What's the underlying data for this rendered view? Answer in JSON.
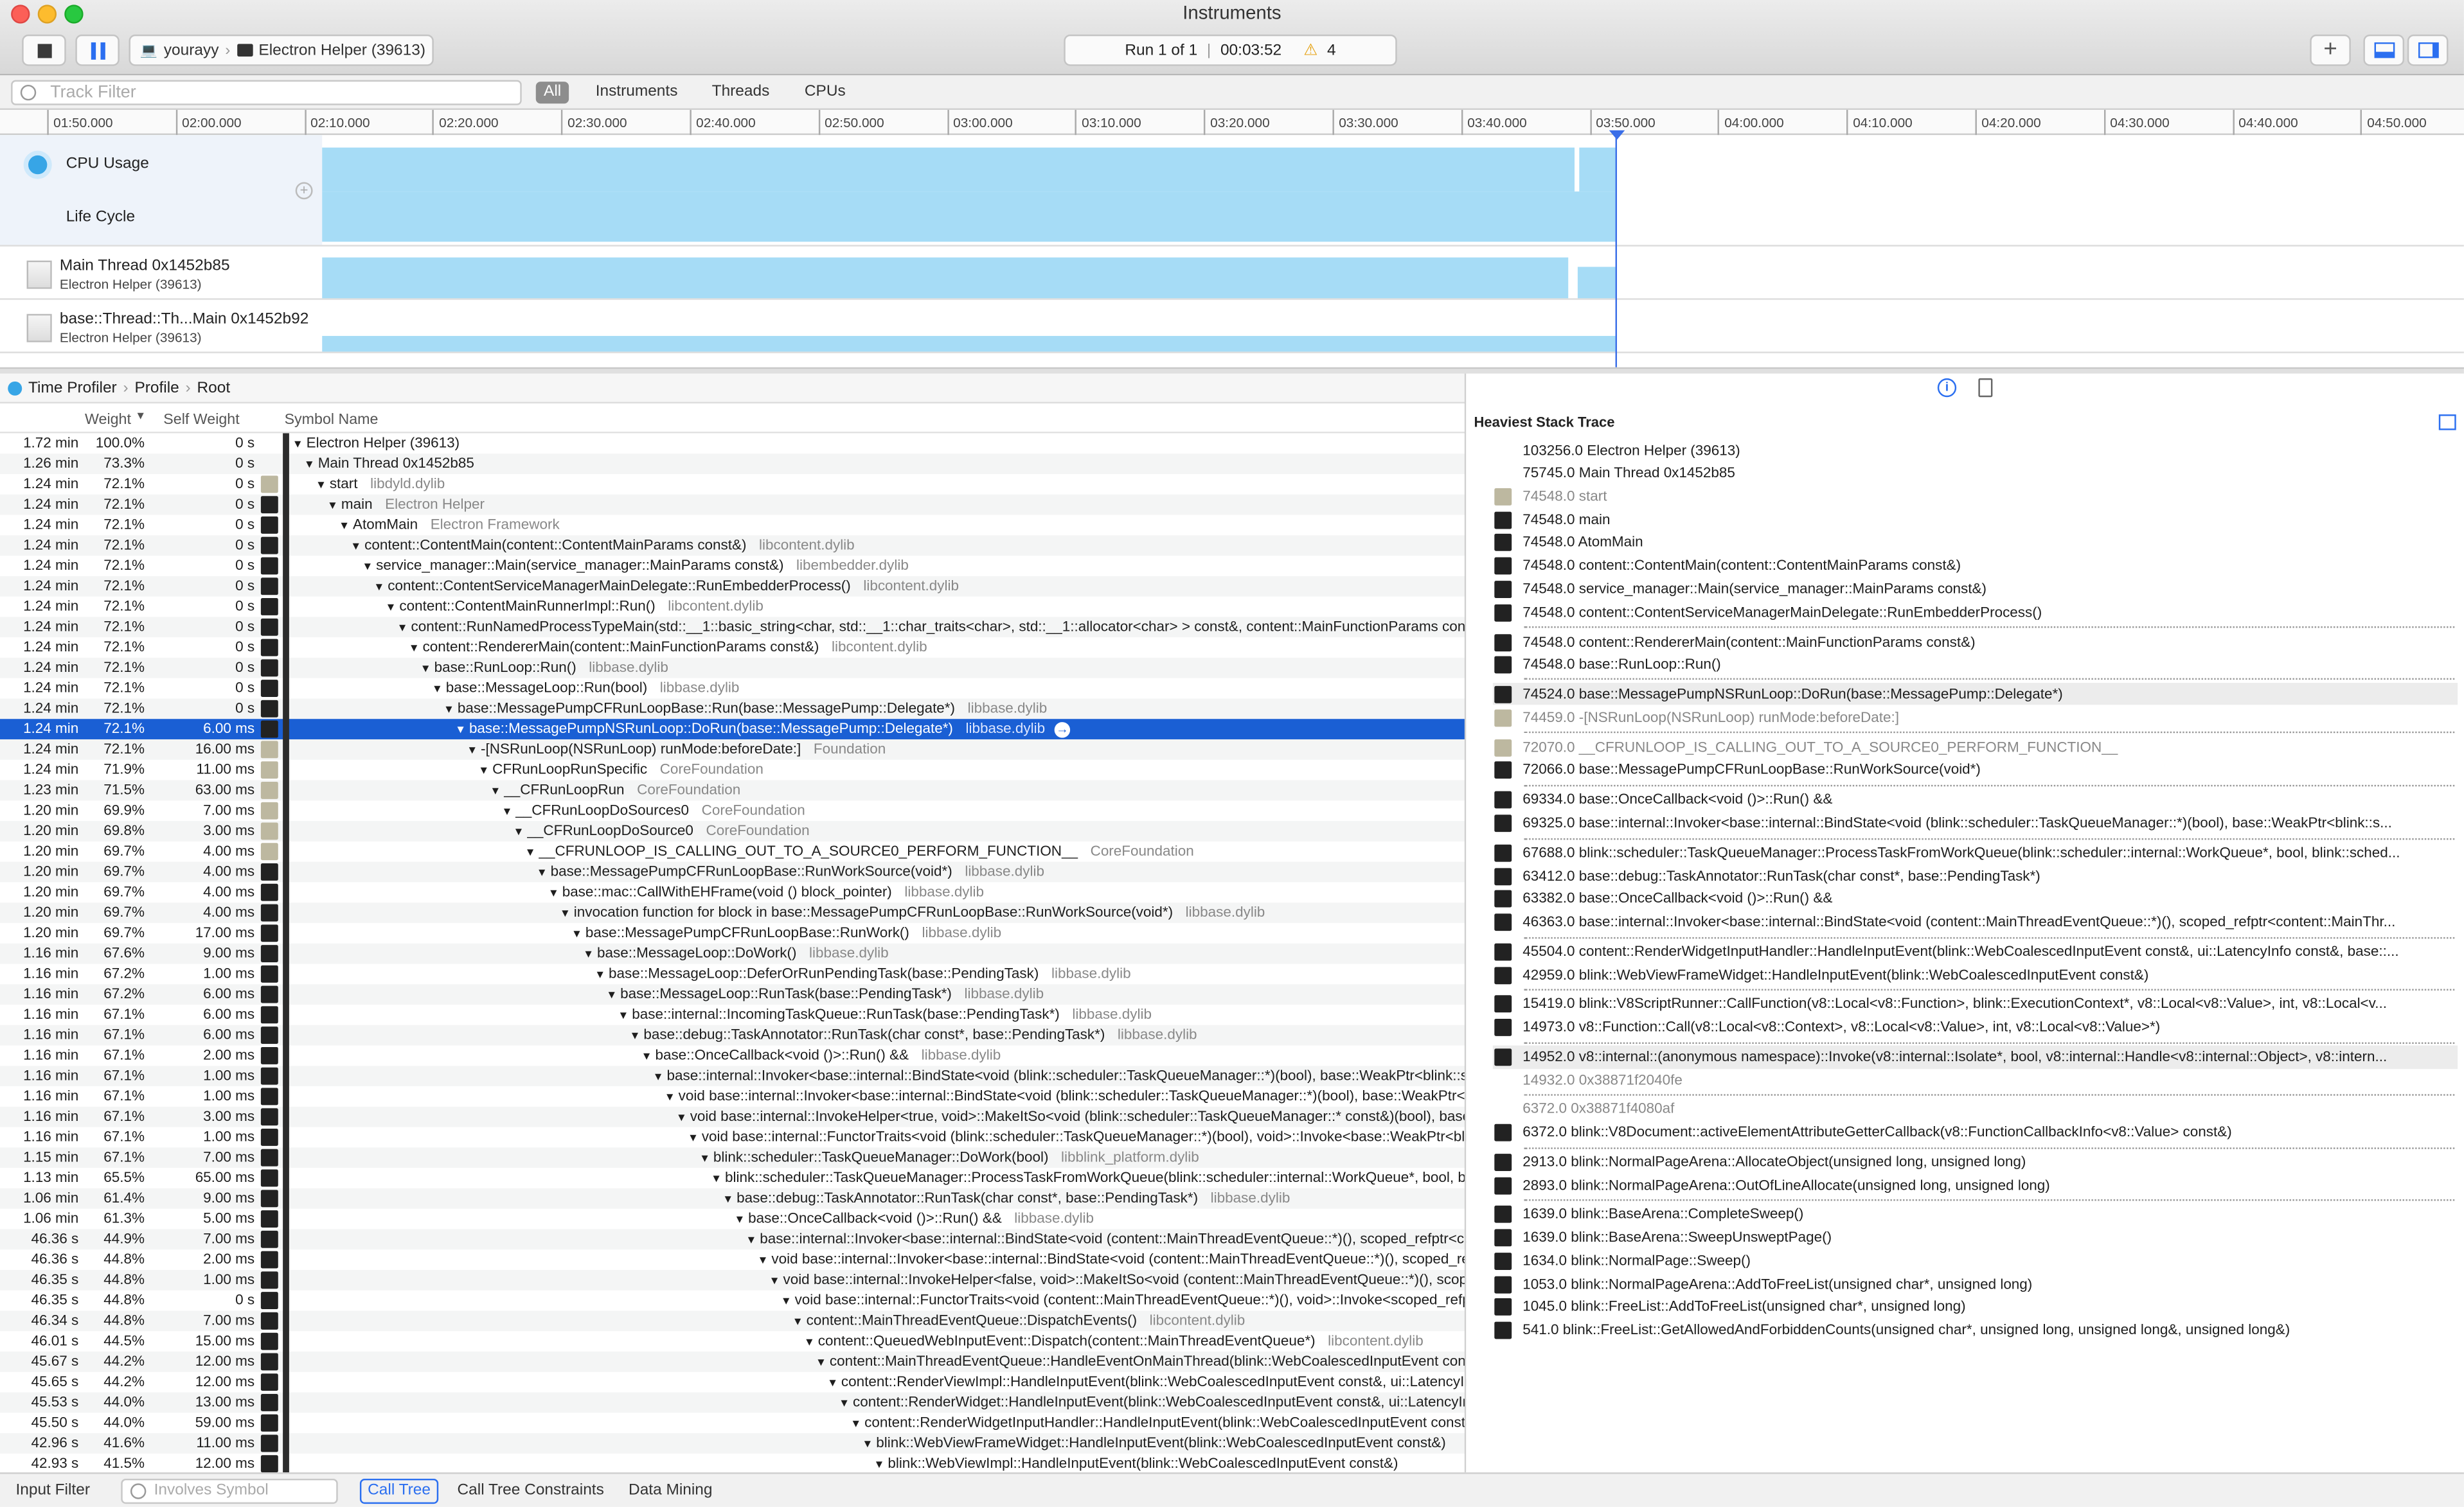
{
  "window": {
    "title": "Instruments"
  },
  "toolbar": {
    "target_device": "yourayy",
    "target_process": "Electron Helper (39613)",
    "run_label": "Run 1 of 1",
    "elapsed": "00:03:52",
    "warning_count": "4"
  },
  "filter": {
    "track_filter_placeholder": "Track Filter",
    "scopes": [
      "All",
      "Instruments",
      "Threads",
      "CPUs"
    ],
    "active_scope": "All"
  },
  "timeline": {
    "ticks": [
      "01:50.000",
      "02:00.000",
      "02:10.000",
      "02:20.000",
      "02:30.000",
      "02:40.000",
      "02:50.000",
      "03:00.000",
      "03:10.000",
      "03:20.000",
      "03:30.000",
      "03:40.000",
      "03:50.000",
      "04:00.000",
      "04:10.000",
      "04:20.000",
      "04:30.000",
      "04:40.000",
      "04:50.000"
    ]
  },
  "tracks": [
    {
      "label": "CPU Usage",
      "sub": ""
    },
    {
      "label": "Life Cycle",
      "sub": ""
    },
    {
      "label": "Main Thread  0x1452b85",
      "sub": "Electron Helper (39613)"
    },
    {
      "label": "base::Thread::Th...Main  0x1452b92",
      "sub": "Electron Helper (39613)"
    }
  ],
  "breadcrumb": {
    "items": [
      "Time Profiler",
      "Profile",
      "Root"
    ]
  },
  "call_tree": {
    "columns": {
      "weight": "Weight",
      "self_weight": "Self Weight",
      "symbol": "Symbol Name"
    },
    "rows": [
      {
        "w": "1.72 min",
        "p": "100.0%",
        "s": "0 s",
        "sym": "Electron Helper (39613)",
        "lib": "",
        "d": 0,
        "icon": "none"
      },
      {
        "w": "1.26 min",
        "p": "73.3%",
        "s": "0 s",
        "sym": "Main Thread  0x1452b85",
        "lib": "",
        "d": 1,
        "icon": "none"
      },
      {
        "w": "1.24 min",
        "p": "72.1%",
        "s": "0 s",
        "sym": "start",
        "lib": "libdyld.dylib",
        "d": 2,
        "icon": "sys"
      },
      {
        "w": "1.24 min",
        "p": "72.1%",
        "s": "0 s",
        "sym": "main",
        "lib": "Electron Helper",
        "d": 3,
        "icon": "user"
      },
      {
        "w": "1.24 min",
        "p": "72.1%",
        "s": "0 s",
        "sym": "AtomMain",
        "lib": "Electron Framework",
        "d": 4,
        "icon": "user"
      },
      {
        "w": "1.24 min",
        "p": "72.1%",
        "s": "0 s",
        "sym": "content::ContentMain(content::ContentMainParams const&)",
        "lib": "libcontent.dylib",
        "d": 5,
        "icon": "user"
      },
      {
        "w": "1.24 min",
        "p": "72.1%",
        "s": "0 s",
        "sym": "service_manager::Main(service_manager::MainParams const&)",
        "lib": "libembedder.dylib",
        "d": 6,
        "icon": "user"
      },
      {
        "w": "1.24 min",
        "p": "72.1%",
        "s": "0 s",
        "sym": "content::ContentServiceManagerMainDelegate::RunEmbedderProcess()",
        "lib": "libcontent.dylib",
        "d": 7,
        "icon": "user"
      },
      {
        "w": "1.24 min",
        "p": "72.1%",
        "s": "0 s",
        "sym": "content::ContentMainRunnerImpl::Run()",
        "lib": "libcontent.dylib",
        "d": 8,
        "icon": "user"
      },
      {
        "w": "1.24 min",
        "p": "72.1%",
        "s": "0 s",
        "sym": "content::RunNamedProcessTypeMain(std::__1::basic_string<char, std::__1::char_traits<char>, std::__1::allocator<char> > const&, content::MainFunctionParams const&, content::ContentMainDelegate*)",
        "lib": "",
        "d": 9,
        "icon": "user"
      },
      {
        "w": "1.24 min",
        "p": "72.1%",
        "s": "0 s",
        "sym": "content::RendererMain(content::MainFunctionParams const&)",
        "lib": "libcontent.dylib",
        "d": 10,
        "icon": "user"
      },
      {
        "w": "1.24 min",
        "p": "72.1%",
        "s": "0 s",
        "sym": "base::RunLoop::Run()",
        "lib": "libbase.dylib",
        "d": 11,
        "icon": "user"
      },
      {
        "w": "1.24 min",
        "p": "72.1%",
        "s": "0 s",
        "sym": "base::MessageLoop::Run(bool)",
        "lib": "libbase.dylib",
        "d": 12,
        "icon": "user"
      },
      {
        "w": "1.24 min",
        "p": "72.1%",
        "s": "0 s",
        "sym": "base::MessagePumpCFRunLoopBase::Run(base::MessagePump::Delegate*)",
        "lib": "libbase.dylib",
        "d": 13,
        "icon": "user"
      },
      {
        "w": "1.24 min",
        "p": "72.1%",
        "s": "6.00 ms",
        "sym": "base::MessagePumpNSRunLoop::DoRun(base::MessagePump::Delegate*)",
        "lib": "libbase.dylib",
        "d": 14,
        "icon": "user",
        "sel": true
      },
      {
        "w": "1.24 min",
        "p": "72.1%",
        "s": "16.00 ms",
        "sym": "-[NSRunLoop(NSRunLoop) runMode:beforeDate:]",
        "lib": "Foundation",
        "d": 15,
        "icon": "sys"
      },
      {
        "w": "1.24 min",
        "p": "71.9%",
        "s": "11.00 ms",
        "sym": "CFRunLoopRunSpecific",
        "lib": "CoreFoundation",
        "d": 16,
        "icon": "sys"
      },
      {
        "w": "1.23 min",
        "p": "71.5%",
        "s": "63.00 ms",
        "sym": "__CFRunLoopRun",
        "lib": "CoreFoundation",
        "d": 17,
        "icon": "sys"
      },
      {
        "w": "1.20 min",
        "p": "69.9%",
        "s": "7.00 ms",
        "sym": "__CFRunLoopDoSources0",
        "lib": "CoreFoundation",
        "d": 18,
        "icon": "sys"
      },
      {
        "w": "1.20 min",
        "p": "69.8%",
        "s": "3.00 ms",
        "sym": "__CFRunLoopDoSource0",
        "lib": "CoreFoundation",
        "d": 19,
        "icon": "sys"
      },
      {
        "w": "1.20 min",
        "p": "69.7%",
        "s": "4.00 ms",
        "sym": "__CFRUNLOOP_IS_CALLING_OUT_TO_A_SOURCE0_PERFORM_FUNCTION__",
        "lib": "CoreFoundation",
        "d": 20,
        "icon": "sys"
      },
      {
        "w": "1.20 min",
        "p": "69.7%",
        "s": "4.00 ms",
        "sym": "base::MessagePumpCFRunLoopBase::RunWorkSource(void*)",
        "lib": "libbase.dylib",
        "d": 21,
        "icon": "user"
      },
      {
        "w": "1.20 min",
        "p": "69.7%",
        "s": "4.00 ms",
        "sym": "base::mac::CallWithEHFrame(void () block_pointer)",
        "lib": "libbase.dylib",
        "d": 22,
        "icon": "user"
      },
      {
        "w": "1.20 min",
        "p": "69.7%",
        "s": "4.00 ms",
        "sym": "invocation function for block in base::MessagePumpCFRunLoopBase::RunWorkSource(void*)",
        "lib": "libbase.dylib",
        "d": 23,
        "icon": "user"
      },
      {
        "w": "1.20 min",
        "p": "69.7%",
        "s": "17.00 ms",
        "sym": "base::MessagePumpCFRunLoopBase::RunWork()",
        "lib": "libbase.dylib",
        "d": 24,
        "icon": "user"
      },
      {
        "w": "1.16 min",
        "p": "67.6%",
        "s": "9.00 ms",
        "sym": "base::MessageLoop::DoWork()",
        "lib": "libbase.dylib",
        "d": 25,
        "icon": "user"
      },
      {
        "w": "1.16 min",
        "p": "67.2%",
        "s": "1.00 ms",
        "sym": "base::MessageLoop::DeferOrRunPendingTask(base::PendingTask)",
        "lib": "libbase.dylib",
        "d": 26,
        "icon": "user"
      },
      {
        "w": "1.16 min",
        "p": "67.2%",
        "s": "6.00 ms",
        "sym": "base::MessageLoop::RunTask(base::PendingTask*)",
        "lib": "libbase.dylib",
        "d": 27,
        "icon": "user"
      },
      {
        "w": "1.16 min",
        "p": "67.1%",
        "s": "6.00 ms",
        "sym": "base::internal::IncomingTaskQueue::RunTask(base::PendingTask*)",
        "lib": "libbase.dylib",
        "d": 28,
        "icon": "user"
      },
      {
        "w": "1.16 min",
        "p": "67.1%",
        "s": "6.00 ms",
        "sym": "base::debug::TaskAnnotator::RunTask(char const*, base::PendingTask*)",
        "lib": "libbase.dylib",
        "d": 29,
        "icon": "user"
      },
      {
        "w": "1.16 min",
        "p": "67.1%",
        "s": "2.00 ms",
        "sym": "base::OnceCallback<void ()>::Run() &&",
        "lib": "libbase.dylib",
        "d": 30,
        "icon": "user"
      },
      {
        "w": "1.16 min",
        "p": "67.1%",
        "s": "1.00 ms",
        "sym": "base::internal::Invoker<base::internal::BindState<void (blink::scheduler::TaskQueueManager::*)(bool), base::WeakPtr<blink::scheduler::TaskQueueManager>, bool>, void ()>::RunOnce(base::internal::BindStateBase*)",
        "lib": "",
        "d": 31,
        "icon": "user"
      },
      {
        "w": "1.16 min",
        "p": "67.1%",
        "s": "1.00 ms",
        "sym": "void base::internal::Invoker<base::internal::BindState<void (blink::scheduler::TaskQueueManager::*)(bool), base::WeakPtr<blink::scheduler::TaskQueueManager>, bool>, void ()>::RunImpl",
        "lib": "",
        "d": 32,
        "icon": "user"
      },
      {
        "w": "1.16 min",
        "p": "67.1%",
        "s": "3.00 ms",
        "sym": "void base::internal::InvokeHelper<true, void>::MakeItSo<void (blink::scheduler::TaskQueueManager::* const&)(bool), base::WeakPtr<blink::scheduler::TaskQueueManager> const&, bool const&>",
        "lib": "",
        "d": 33,
        "icon": "user"
      },
      {
        "w": "1.16 min",
        "p": "67.1%",
        "s": "1.00 ms",
        "sym": "void base::internal::FunctorTraits<void (blink::scheduler::TaskQueueManager::*)(bool), void>::Invoke<base::WeakPtr<blink::scheduler::TaskQueueManager> const&, bool const&>",
        "lib": "",
        "d": 34,
        "icon": "user"
      },
      {
        "w": "1.15 min",
        "p": "67.1%",
        "s": "7.00 ms",
        "sym": "blink::scheduler::TaskQueueManager::DoWork(bool)",
        "lib": "libblink_platform.dylib",
        "d": 35,
        "icon": "user"
      },
      {
        "w": "1.13 min",
        "p": "65.5%",
        "s": "65.00 ms",
        "sym": "blink::scheduler::TaskQueueManager::ProcessTaskFromWorkQueue(blink::scheduler::internal::WorkQueue*, bool, blink::scheduler::LazyNow, base::TimeTicks*)",
        "lib": "",
        "d": 36,
        "icon": "user"
      },
      {
        "w": "1.06 min",
        "p": "61.4%",
        "s": "9.00 ms",
        "sym": "base::debug::TaskAnnotator::RunTask(char const*, base::PendingTask*)",
        "lib": "libbase.dylib",
        "d": 37,
        "icon": "user"
      },
      {
        "w": "1.06 min",
        "p": "61.3%",
        "s": "5.00 ms",
        "sym": "base::OnceCallback<void ()>::Run() &&",
        "lib": "libbase.dylib",
        "d": 38,
        "icon": "user"
      },
      {
        "w": "46.36 s",
        "p": "44.9%",
        "s": "7.00 ms",
        "sym": "base::internal::Invoker<base::internal::BindState<void (content::MainThreadEventQueue::*)(), scoped_refptr<content::MainThreadEventQueue> >, void ()>::RunOnce(base::internal::BindStateBase*)",
        "lib": "",
        "d": 39,
        "icon": "user"
      },
      {
        "w": "46.36 s",
        "p": "44.8%",
        "s": "2.00 ms",
        "sym": "void base::internal::Invoker<base::internal::BindState<void (content::MainThreadEventQueue::*)(), scoped_refptr<content::MainThreadEventQueue> >, void ()>::RunImpl",
        "lib": "",
        "d": 40,
        "icon": "user"
      },
      {
        "w": "46.35 s",
        "p": "44.8%",
        "s": "1.00 ms",
        "sym": "void base::internal::InvokeHelper<false, void>::MakeItSo<void (content::MainThreadEventQueue::*)(), scoped_refptr<content::MainThreadEventQueue> >",
        "lib": "",
        "d": 41,
        "icon": "user"
      },
      {
        "w": "46.35 s",
        "p": "44.8%",
        "s": "0 s",
        "sym": "void base::internal::FunctorTraits<void (content::MainThreadEventQueue::*)(), void>::Invoke<scoped_refptr<content::MainThreadEventQueue> >",
        "lib": "",
        "d": 42,
        "icon": "user"
      },
      {
        "w": "46.34 s",
        "p": "44.8%",
        "s": "7.00 ms",
        "sym": "content::MainThreadEventQueue::DispatchEvents()",
        "lib": "libcontent.dylib",
        "d": 43,
        "icon": "user"
      },
      {
        "w": "46.01 s",
        "p": "44.5%",
        "s": "15.00 ms",
        "sym": "content::QueuedWebInputEvent::Dispatch(content::MainThreadEventQueue*)",
        "lib": "libcontent.dylib",
        "d": 44,
        "icon": "user"
      },
      {
        "w": "45.67 s",
        "p": "44.2%",
        "s": "12.00 ms",
        "sym": "content::MainThreadEventQueue::HandleEventOnMainThread(blink::WebCoalescedInputEvent const&, ui::LatencyInfo const&, content::InputEventDispatchType)",
        "lib": "",
        "d": 45,
        "icon": "user"
      },
      {
        "w": "45.65 s",
        "p": "44.2%",
        "s": "12.00 ms",
        "sym": "content::RenderViewImpl::HandleInputEvent(blink::WebCoalescedInputEvent const&, ui::LatencyInfo const&, content::InputEventDispatchType)",
        "lib": "",
        "d": 46,
        "icon": "user"
      },
      {
        "w": "45.53 s",
        "p": "44.0%",
        "s": "13.00 ms",
        "sym": "content::RenderWidget::HandleInputEvent(blink::WebCoalescedInputEvent const&, ui::LatencyInfo const&, content::InputEventDispatchType)",
        "lib": "",
        "d": 47,
        "icon": "user"
      },
      {
        "w": "45.50 s",
        "p": "44.0%",
        "s": "59.00 ms",
        "sym": "content::RenderWidgetInputHandler::HandleInputEvent(blink::WebCoalescedInputEvent const&, ui::LatencyInfo const&)",
        "lib": "",
        "d": 48,
        "icon": "user"
      },
      {
        "w": "42.96 s",
        "p": "41.6%",
        "s": "11.00 ms",
        "sym": "blink::WebViewFrameWidget::HandleInputEvent(blink::WebCoalescedInputEvent const&)",
        "lib": "",
        "d": 49,
        "icon": "user"
      },
      {
        "w": "42.93 s",
        "p": "41.5%",
        "s": "12.00 ms",
        "sym": "blink::WebViewImpl::HandleInputEvent(blink::WebCoalescedInputEvent const&)",
        "lib": "",
        "d": 50,
        "icon": "user"
      }
    ]
  },
  "heaviest": {
    "title": "Heaviest Stack Trace",
    "rows": [
      {
        "v": "103256.0  Electron Helper (39613)",
        "icon": "none"
      },
      {
        "v": "75745.0  Main Thread  0x1452b85",
        "icon": "none"
      },
      {
        "v": "74548.0  start",
        "icon": "sys",
        "dim": true
      },
      {
        "v": "74548.0  main",
        "icon": "user"
      },
      {
        "v": "74548.0  AtomMain",
        "icon": "user"
      },
      {
        "v": "74548.0  content::ContentMain(content::ContentMainParams const&)",
        "icon": "user"
      },
      {
        "v": "74548.0  service_manager::Main(service_manager::MainParams const&)",
        "icon": "user"
      },
      {
        "v": "74548.0  content::ContentServiceManagerMainDelegate::RunEmbedderProcess()",
        "icon": "user"
      },
      {
        "v": "74548.0  content::RendererMain(content::MainFunctionParams const&)",
        "icon": "user"
      },
      {
        "v": "74548.0  base::RunLoop::Run()",
        "icon": "user"
      },
      {
        "v": "74524.0  base::MessagePumpNSRunLoop::DoRun(base::MessagePump::Delegate*)",
        "icon": "user",
        "gray": true
      },
      {
        "v": "74459.0  -[NSRunLoop(NSRunLoop) runMode:beforeDate:]",
        "icon": "sys",
        "dim": true
      },
      {
        "v": "72070.0  __CFRUNLOOP_IS_CALLING_OUT_TO_A_SOURCE0_PERFORM_FUNCTION__",
        "icon": "sys",
        "dim": true
      },
      {
        "v": "72066.0  base::MessagePumpCFRunLoopBase::RunWorkSource(void*)",
        "icon": "user"
      },
      {
        "v": "69334.0  base::OnceCallback<void ()>::Run() &&",
        "icon": "user"
      },
      {
        "v": "69325.0  base::internal::Invoker<base::internal::BindState<void (blink::scheduler::TaskQueueManager::*)(bool), base::WeakPtr<blink::s...",
        "icon": "user"
      },
      {
        "v": "67688.0  blink::scheduler::TaskQueueManager::ProcessTaskFromWorkQueue(blink::scheduler::internal::WorkQueue*, bool, blink::sched...",
        "icon": "user"
      },
      {
        "v": "63412.0  base::debug::TaskAnnotator::RunTask(char const*, base::PendingTask*)",
        "icon": "user"
      },
      {
        "v": "63382.0  base::OnceCallback<void ()>::Run() &&",
        "icon": "user"
      },
      {
        "v": "46363.0  base::internal::Invoker<base::internal::BindState<void (content::MainThreadEventQueue::*)(), scoped_refptr<content::MainThr...",
        "icon": "user"
      },
      {
        "v": "45504.0  content::RenderWidgetInputHandler::HandleInputEvent(blink::WebCoalescedInputEvent const&, ui::LatencyInfo const&, base::...",
        "icon": "user"
      },
      {
        "v": "42959.0  blink::WebViewFrameWidget::HandleInputEvent(blink::WebCoalescedInputEvent const&)",
        "icon": "user"
      },
      {
        "v": "15419.0  blink::V8ScriptRunner::CallFunction(v8::Local<v8::Function>, blink::ExecutionContext*, v8::Local<v8::Value>, int, v8::Local<v...",
        "icon": "user"
      },
      {
        "v": "14973.0  v8::Function::Call(v8::Local<v8::Context>, v8::Local<v8::Value>, int, v8::Local<v8::Value>*)",
        "icon": "user"
      },
      {
        "v": "14952.0  v8::internal::(anonymous namespace)::Invoke(v8::internal::Isolate*, bool, v8::internal::Handle<v8::internal::Object>, v8::intern...",
        "icon": "user",
        "gray": true
      },
      {
        "v": "14932.0  0x38871f2040fe",
        "icon": "none",
        "dim": true
      },
      {
        "v": "6372.0  0x38871f4080af",
        "icon": "none",
        "dim": true
      },
      {
        "v": "6372.0  blink::V8Document::activeElementAttributeGetterCallback(v8::FunctionCallbackInfo<v8::Value> const&)",
        "icon": "user"
      },
      {
        "v": "2913.0  blink::NormalPageArena::AllocateObject(unsigned long, unsigned long)",
        "icon": "user"
      },
      {
        "v": "2893.0  blink::NormalPageArena::OutOfLineAllocate(unsigned long, unsigned long)",
        "icon": "user"
      },
      {
        "v": "1639.0  blink::BaseArena::CompleteSweep()",
        "icon": "user"
      },
      {
        "v": "1639.0  blink::BaseArena::SweepUnsweptPage()",
        "icon": "user"
      },
      {
        "v": "1634.0  blink::NormalPage::Sweep()",
        "icon": "user"
      },
      {
        "v": "1053.0  blink::NormalPageArena::AddToFreeList(unsigned char*, unsigned long)",
        "icon": "user"
      },
      {
        "v": "1045.0  blink::FreeList::AddToFreeList(unsigned char*, unsigned long)",
        "icon": "user"
      },
      {
        "v": "541.0  blink::FreeList::GetAllowedAndForbiddenCounts(unsigned char*, unsigned long, unsigned long&, unsigned long&)",
        "icon": "user"
      }
    ]
  },
  "bottom": {
    "input_filter": "Input Filter",
    "involves_symbol_placeholder": "Involves Symbol",
    "tabs": [
      "Call Tree",
      "Call Tree Constraints",
      "Data Mining"
    ],
    "active_tab": "Call Tree"
  },
  "colors": {
    "accent": "#1a5fd4",
    "graph": "#a6dcf6",
    "playhead": "#3a6ee8"
  }
}
